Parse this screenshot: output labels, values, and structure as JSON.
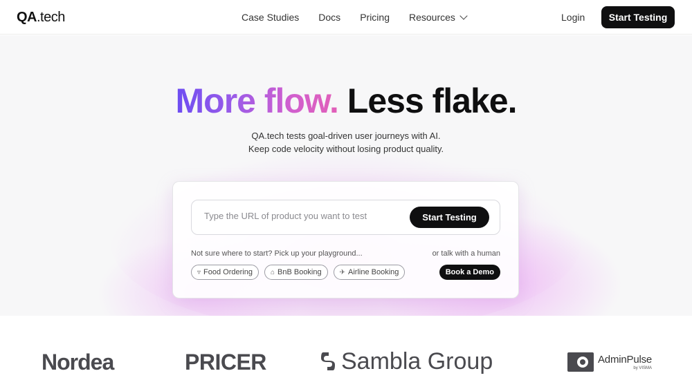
{
  "nav": {
    "logo_bold": "QA",
    "logo_rest": ".tech",
    "items": [
      {
        "label": "Case Studies"
      },
      {
        "label": "Docs"
      },
      {
        "label": "Pricing"
      },
      {
        "label": "Resources"
      }
    ],
    "login_label": "Login",
    "cta_label": "Start Testing"
  },
  "hero": {
    "headline_gradient": "More flow.",
    "headline_dark": "Less flake.",
    "subtitle_line1": "QA.tech tests goal-driven user journeys with AI.",
    "subtitle_line2": "Keep code velocity without losing product quality.",
    "gradient_colors": [
      "#6d4df2",
      "#9a5be8",
      "#d05fcf",
      "#e25fb8"
    ]
  },
  "card": {
    "url_placeholder": "Type the URL of product you want to test",
    "url_value": "",
    "cta_label": "Start Testing",
    "hint_left": "Not sure where to start? Pick up your playground...",
    "hint_right": "or talk with a human",
    "chips": [
      {
        "label": "Food Ordering",
        "icon": "ice-cream-icon"
      },
      {
        "label": "BnB Booking",
        "icon": "house-icon"
      },
      {
        "label": "Airline Booking",
        "icon": "plane-icon"
      }
    ],
    "demo_label": "Book a Demo"
  },
  "logos": {
    "nordea": "Nordea",
    "pricer": "PRICER",
    "sambla": "Sambla Group",
    "adminpulse_name": "AdminPulse",
    "adminpulse_by": "by VISMA"
  },
  "colors": {
    "dark": "#0f0f10",
    "hero_bg": "#f7f7f8",
    "glow": "#e6aaf0"
  }
}
